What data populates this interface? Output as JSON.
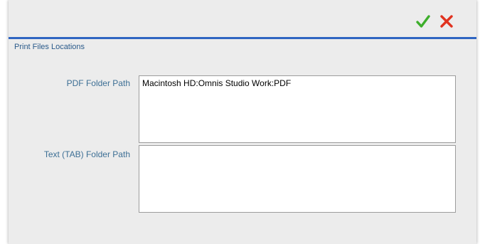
{
  "toolbar": {
    "ok_icon": "checkmark-icon",
    "ok_color": "#3dae2b",
    "cancel_icon": "x-icon",
    "cancel_color": "#e0321f"
  },
  "section": {
    "title": "Print Files Locations"
  },
  "fields": {
    "pdf": {
      "label": "PDF Folder Path",
      "value": "Macintosh HD:Omnis Studio Work:PDF"
    },
    "text": {
      "label": "Text (TAB) Folder Path",
      "value": ""
    }
  },
  "colors": {
    "accent_rule": "#2f65c2",
    "label_text": "#3d6f95"
  }
}
